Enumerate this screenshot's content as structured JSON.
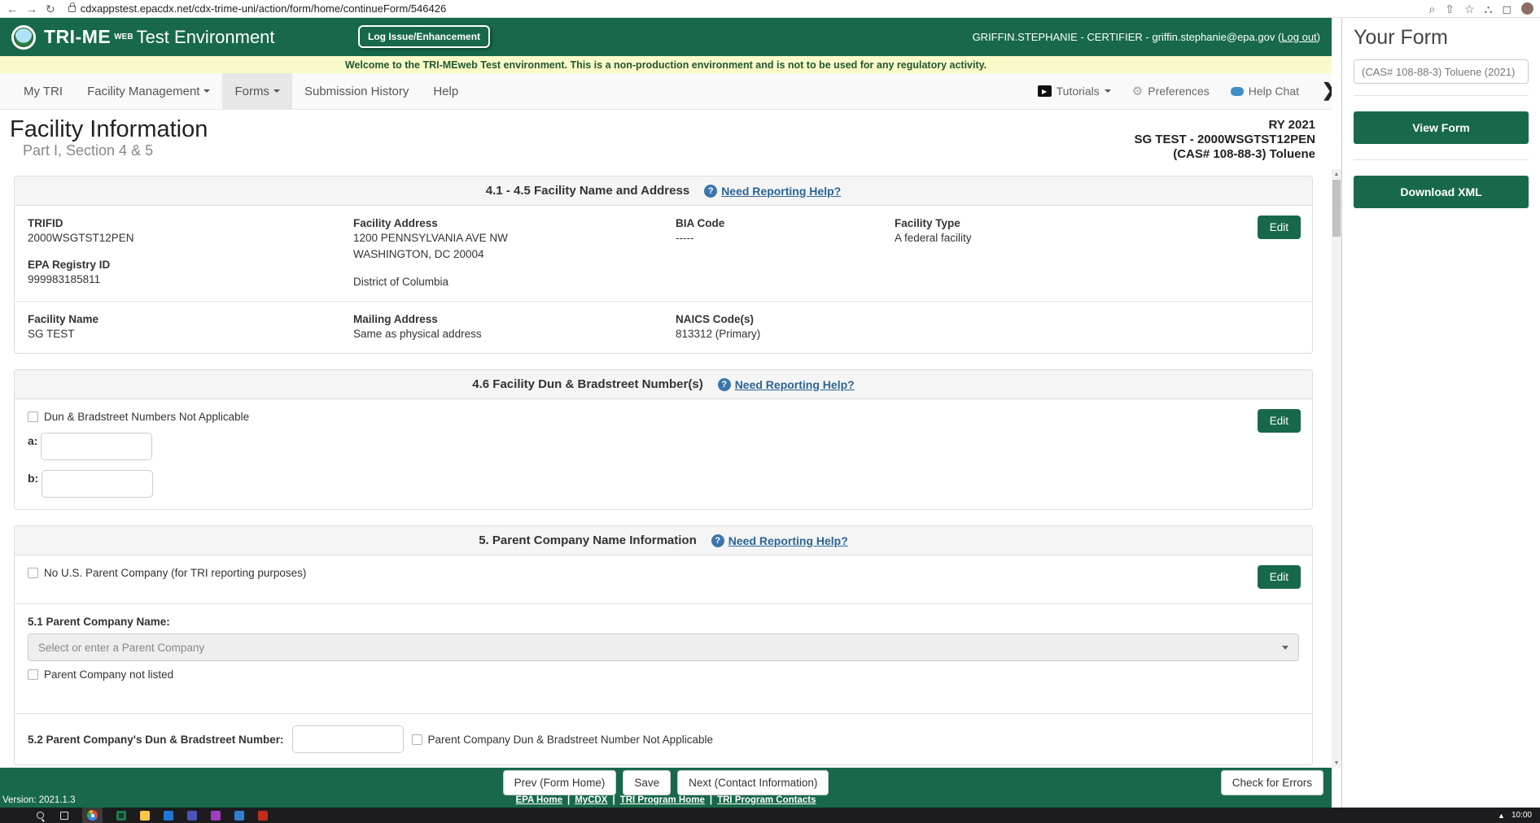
{
  "browser": {
    "url": "cdxappstest.epacdx.net/cdx-trime-uni/action/form/home/continueForm/546426"
  },
  "header": {
    "brand": "TRI-ME",
    "brand_web": "WEB",
    "environment": "Test Environment",
    "log_issue_button": "Log Issue/Enhancement",
    "user_prefix": "GRIFFIN.STEPHANIE - CERTIFIER - griffin.stephanie@epa.gov (",
    "logout_label": "Log out",
    "user_suffix": ")"
  },
  "banner": {
    "message": "Welcome to the TRI-MEweb Test environment. This is a non-production environment and is not to be used for any regulatory activity."
  },
  "nav": {
    "items": [
      {
        "label": "My TRI"
      },
      {
        "label": "Facility Management"
      },
      {
        "label": "Forms"
      },
      {
        "label": "Submission History"
      },
      {
        "label": "Help"
      }
    ],
    "tutorials": "Tutorials",
    "preferences": "Preferences",
    "help_chat": "Help Chat"
  },
  "page": {
    "title": "Facility Information",
    "subtitle": "Part I, Section 4 & 5",
    "reporting_year": "RY 2021",
    "facility": "SG TEST - 2000WSGTST12PEN",
    "chemical": "(CAS# 108-88-3) Toluene"
  },
  "section_45": {
    "title": "4.1 - 4.5 Facility Name and Address",
    "help_link": "Need Reporting Help?",
    "edit_label": "Edit",
    "trifid_label": "TRIFID",
    "trifid": "2000WSGTST12PEN",
    "epa_registry_label": "EPA Registry ID",
    "epa_registry": "999983185811",
    "facility_address_label": "Facility Address",
    "address_line1": "1200 PENNSYLVANIA AVE NW",
    "address_line2": "WASHINGTON, DC 20004",
    "address_line3": "District of Columbia",
    "bia_label": "BIA Code",
    "bia": "-----",
    "facility_type_label": "Facility Type",
    "facility_type": "A federal facility",
    "facility_name_label": "Facility Name",
    "facility_name": "SG TEST",
    "mailing_label": "Mailing Address",
    "mailing": "Same as physical address",
    "naics_label": "NAICS Code(s)",
    "naics": "813312 (Primary)"
  },
  "section_46": {
    "title": "4.6 Facility Dun & Bradstreet Number(s)",
    "help_link": "Need Reporting Help?",
    "edit_label": "Edit",
    "na_checkbox": "Dun & Bradstreet Numbers Not Applicable",
    "field_a_label": "a:",
    "field_b_label": "b:"
  },
  "section_5": {
    "title": "5. Parent Company Name Information",
    "help_link": "Need Reporting Help?",
    "edit_label": "Edit",
    "no_parent_checkbox": "No U.S. Parent Company (for TRI reporting purposes)",
    "parent_name_label": "5.1 Parent Company Name:",
    "parent_select_placeholder": "Select or enter a Parent Company",
    "not_listed_checkbox": "Parent Company not listed",
    "dnb_label": "5.2 Parent Company's Dun & Bradstreet Number:",
    "dnb_na_checkbox": "Parent Company Dun & Bradstreet Number Not Applicable"
  },
  "footer": {
    "version": "Version: 2021.1.3",
    "prev_button": "Prev (Form Home)",
    "save_button": "Save",
    "next_button": "Next (Contact Information)",
    "check_errors_button": "Check for Errors",
    "separator": "|",
    "links": [
      {
        "label": "EPA Home"
      },
      {
        "label": "MyCDX"
      },
      {
        "label": "TRI Program Home"
      },
      {
        "label": "TRI Program Contacts"
      }
    ]
  },
  "sidebar": {
    "title": "Your Form",
    "form_select": "(CAS# 108-88-3) Toluene (2021)",
    "view_form_button": "View Form",
    "download_xml_button": "Download XML"
  },
  "taskbar": {
    "time": "10:00"
  }
}
